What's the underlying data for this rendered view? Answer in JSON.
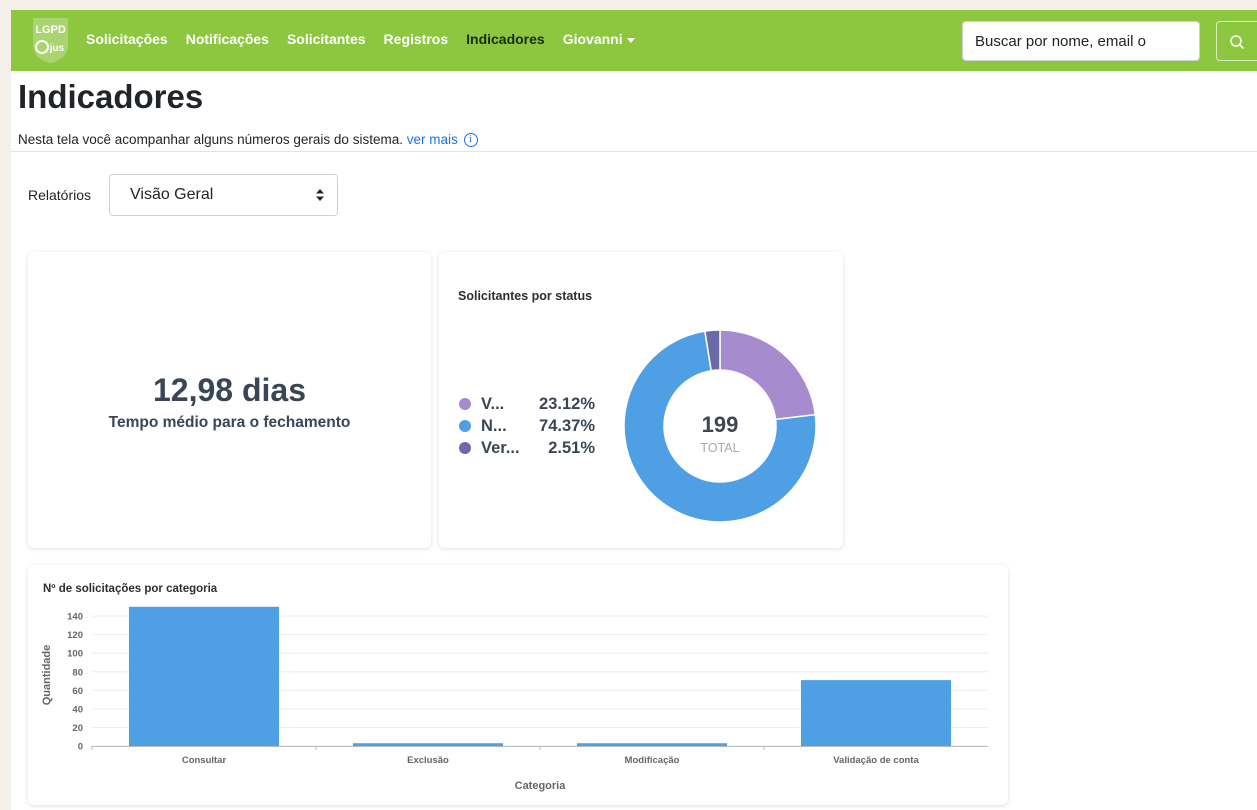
{
  "navbar": {
    "logo_text_top": "LGPD",
    "logo_text_bottom": "jus",
    "links": [
      {
        "label": "Solicitações"
      },
      {
        "label": "Notificações"
      },
      {
        "label": "Solicitantes"
      },
      {
        "label": "Registros"
      },
      {
        "label": "Indicadores",
        "active": true
      },
      {
        "label": "Giovanni",
        "dropdown": true
      }
    ],
    "search_value": "Buscar por nome, email o",
    "search_icon": "search-icon",
    "brand_color": "#8dc63f"
  },
  "header": {
    "title": "Indicadores",
    "description": "Nesta tela você acompanhar alguns números gerais do sistema.",
    "more_link": "ver mais",
    "info_icon": "info-circle-icon"
  },
  "report": {
    "label": "Relatórios",
    "selected": "Visão Geral"
  },
  "avg_closing": {
    "value": "12,98 dias",
    "caption": "Tempo médio para o fechamento"
  },
  "status_card": {
    "total_value": "199",
    "total_label": "TOTAL"
  },
  "chart_data": [
    {
      "type": "pie",
      "title": "Solicitantes por status",
      "donut": true,
      "labels": [
        "V...",
        "N...",
        "Ver..."
      ],
      "percent_labels": [
        "23.12%",
        "74.37%",
        "2.51%"
      ],
      "values": [
        23.12,
        74.37,
        2.51
      ],
      "colors": [
        "#a68bcf",
        "#4f9fe5",
        "#6b6aa8"
      ],
      "legend": "left"
    },
    {
      "type": "bar",
      "title": "Nº de solicitações por categoria",
      "xlabel": "Categoria",
      "ylabel": "Quantidade",
      "categories": [
        "Consultar",
        "Exclusão",
        "Modificação",
        "Validação de conta"
      ],
      "values": [
        150,
        3,
        3,
        71
      ],
      "yticks": [
        0,
        20,
        40,
        60,
        80,
        100,
        120,
        140
      ],
      "ylim": [
        0,
        153
      ],
      "color": "#4f9fe5",
      "grid": true
    }
  ]
}
